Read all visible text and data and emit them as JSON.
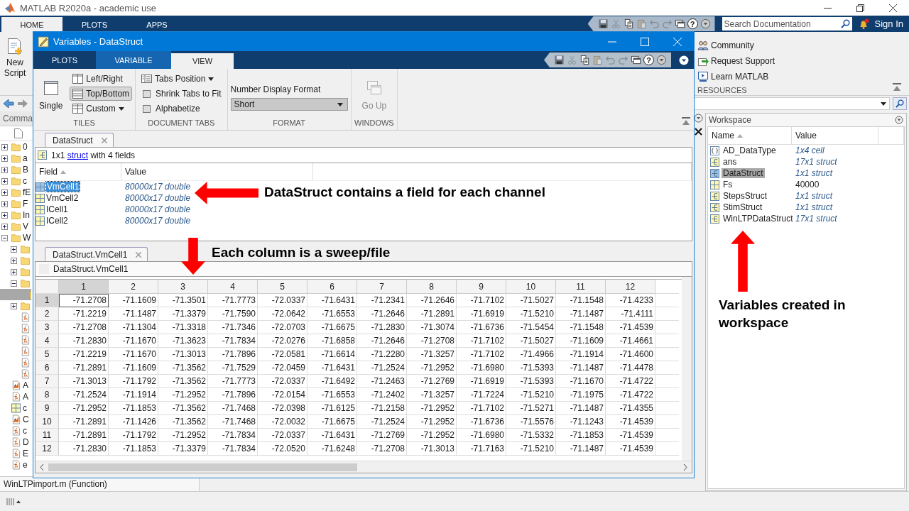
{
  "title": "MATLAB R2020a - academic use",
  "main_tabs": [
    {
      "label": "HOME",
      "selected": true
    },
    {
      "label": "PLOTS",
      "selected": false
    },
    {
      "label": "APPS",
      "selected": false
    }
  ],
  "quick_access": {
    "help": "?"
  },
  "search": {
    "placeholder": "Search Documentation"
  },
  "sign_in": "Sign In",
  "new_script": "New Script",
  "resources": {
    "group_label": "RESOURCES",
    "items": [
      {
        "label": "Community",
        "kind": "community"
      },
      {
        "label": "Request Support",
        "kind": "support"
      },
      {
        "label": "Learn MATLAB",
        "kind": "learn"
      }
    ]
  },
  "current_folder": {
    "header": "Comma",
    "items": [
      {
        "kind": "folder",
        "label": "0",
        "expanded": false,
        "selected": false
      },
      {
        "kind": "folder",
        "label": "a",
        "expanded": false,
        "selected": false
      },
      {
        "kind": "folder",
        "label": "B",
        "expanded": false,
        "selected": false
      },
      {
        "kind": "folder",
        "label": "c",
        "expanded": false,
        "selected": false
      },
      {
        "kind": "folder",
        "label": "fE",
        "expanded": false,
        "selected": false
      },
      {
        "kind": "folder",
        "label": "F",
        "expanded": false,
        "selected": false
      },
      {
        "kind": "folder",
        "label": "In",
        "expanded": false,
        "selected": false
      },
      {
        "kind": "folder",
        "label": "V",
        "expanded": false,
        "selected": false
      },
      {
        "kind": "folder",
        "label": "W",
        "expanded": true,
        "selected": false,
        "children": [
          {
            "kind": "folder",
            "expanded": false,
            "selected": false
          },
          {
            "kind": "folder",
            "expanded": false,
            "selected": false
          },
          {
            "kind": "folder",
            "expanded": false,
            "selected": false
          },
          {
            "kind": "folder",
            "expanded": true,
            "selected": false,
            "children": [
              {
                "kind": "folder",
                "selected": true
              }
            ]
          },
          {
            "kind": "folder",
            "expanded": false,
            "selected": false
          },
          {
            "kind": "function",
            "selected": false
          },
          {
            "kind": "function",
            "selected": false
          },
          {
            "kind": "function",
            "selected": false
          },
          {
            "kind": "function",
            "selected": false
          },
          {
            "kind": "function",
            "selected": false
          },
          {
            "kind": "function",
            "selected": false
          }
        ]
      },
      {
        "kind": "live",
        "label": "A",
        "selected": false
      },
      {
        "kind": "function",
        "label": "A",
        "selected": false
      },
      {
        "kind": "data",
        "label": "c",
        "selected": false
      },
      {
        "kind": "live",
        "label": "C",
        "selected": false
      },
      {
        "kind": "function",
        "label": "c",
        "selected": false
      },
      {
        "kind": "function",
        "label": "D",
        "selected": false
      },
      {
        "kind": "function",
        "label": "E",
        "selected": false
      },
      {
        "kind": "function",
        "label": "e",
        "selected": false
      }
    ]
  },
  "editor_status": "WinLTPimport.m  (Function)",
  "workspace": {
    "title": "Workspace",
    "columns": [
      "Name",
      "Value"
    ],
    "rows": [
      {
        "name": "AD_DataType",
        "value": "1x4 cell",
        "kind": "cell",
        "selected": false
      },
      {
        "name": "ans",
        "value": "17x1 struct",
        "kind": "struct",
        "selected": false
      },
      {
        "name": "DataStruct",
        "value": "1x1 struct",
        "kind": "struct",
        "selected": true
      },
      {
        "name": "Fs",
        "value": "40000",
        "kind": "scalar",
        "selected": false
      },
      {
        "name": "StepsStruct",
        "value": "1x1 struct",
        "kind": "struct",
        "selected": false
      },
      {
        "name": "StimStruct",
        "value": "1x1 struct",
        "kind": "struct",
        "selected": false
      },
      {
        "name": "WinLTPDataStruct",
        "value": "17x1 struct",
        "kind": "struct",
        "selected": false
      }
    ]
  },
  "variables_window": {
    "title": "Variables - DataStruct",
    "tabs": [
      {
        "label": "PLOTS",
        "selected": false
      },
      {
        "label": "VARIABLE",
        "selected": false
      },
      {
        "label": "VIEW",
        "selected": true
      }
    ],
    "quick_access": {
      "help": "?"
    },
    "tiles": {
      "label": "TILES",
      "buttons": [
        {
          "label": "Single",
          "kind": "large",
          "selected": false
        },
        {
          "label": "Left/Right",
          "kind": "small",
          "selected": false
        },
        {
          "label": "Top/Bottom",
          "kind": "small",
          "selected": true
        },
        {
          "label": "Custom",
          "kind": "menu",
          "selected": false
        }
      ]
    },
    "document_tabs": {
      "label": "DOCUMENT TABS",
      "tabs_position": "Tabs Position",
      "checkboxes": [
        {
          "label": "Shrink Tabs to Fit",
          "checked": false
        },
        {
          "label": "Alphabetize",
          "checked": false
        }
      ]
    },
    "format": {
      "label": "FORMAT",
      "field_label": "Number Display Format",
      "value": "Short"
    },
    "windows": {
      "label": "WINDOWS",
      "go_up": {
        "label": "Go Up",
        "disabled": true
      }
    },
    "struct_tab": "DataStruct",
    "summary": {
      "before": "1x1",
      "link": "struct",
      "after": "with 4 fields"
    },
    "fields": {
      "columns": [
        "Field",
        "Value"
      ],
      "rows": [
        {
          "name": "VmCell1",
          "value": "80000x17 double",
          "selected": true
        },
        {
          "name": "VmCell2",
          "value": "80000x17 double",
          "selected": false
        },
        {
          "name": "ICell1",
          "value": "80000x17 double",
          "selected": false
        },
        {
          "name": "ICell2",
          "value": "80000x17 double",
          "selected": false
        }
      ]
    },
    "matrix_tab": "DataStruct.VmCell1",
    "matrix_path": "DataStruct.VmCell1",
    "grid": {
      "columns": [
        {
          "label": "1",
          "selected": true
        },
        {
          "label": "2",
          "selected": false
        },
        {
          "label": "3",
          "selected": false
        },
        {
          "label": "4",
          "selected": false
        },
        {
          "label": "5",
          "selected": false
        },
        {
          "label": "6",
          "selected": false
        },
        {
          "label": "7",
          "selected": false
        },
        {
          "label": "8",
          "selected": false
        },
        {
          "label": "9",
          "selected": false
        },
        {
          "label": "10",
          "selected": false
        },
        {
          "label": "11",
          "selected": false
        },
        {
          "label": "12",
          "selected": false
        }
      ],
      "rows": [
        {
          "label": "1",
          "selected": true,
          "cells": [
            "-71.2708",
            "-71.1609",
            "-71.3501",
            "-71.7773",
            "-72.0337",
            "-71.6431",
            "-71.2341",
            "-71.2646",
            "-71.7102",
            "-71.5027",
            "-71.1548",
            "-71.4233"
          ]
        },
        {
          "label": "2",
          "selected": false,
          "cells": [
            "-71.2219",
            "-71.1487",
            "-71.3379",
            "-71.7590",
            "-72.0642",
            "-71.6553",
            "-71.2646",
            "-71.2891",
            "-71.6919",
            "-71.5210",
            "-71.1487",
            "-71.4111"
          ]
        },
        {
          "label": "3",
          "selected": false,
          "cells": [
            "-71.2708",
            "-71.1304",
            "-71.3318",
            "-71.7346",
            "-72.0703",
            "-71.6675",
            "-71.2830",
            "-71.3074",
            "-71.6736",
            "-71.5454",
            "-71.1548",
            "-71.4539"
          ]
        },
        {
          "label": "4",
          "selected": false,
          "cells": [
            "-71.2830",
            "-71.1670",
            "-71.3623",
            "-71.7834",
            "-72.0276",
            "-71.6858",
            "-71.2646",
            "-71.2708",
            "-71.7102",
            "-71.5027",
            "-71.1609",
            "-71.4661"
          ]
        },
        {
          "label": "5",
          "selected": false,
          "cells": [
            "-71.2219",
            "-71.1670",
            "-71.3013",
            "-71.7896",
            "-72.0581",
            "-71.6614",
            "-71.2280",
            "-71.3257",
            "-71.7102",
            "-71.4966",
            "-71.1914",
            "-71.4600"
          ]
        },
        {
          "label": "6",
          "selected": false,
          "cells": [
            "-71.2891",
            "-71.1609",
            "-71.3562",
            "-71.7529",
            "-72.0459",
            "-71.6431",
            "-71.2524",
            "-71.2952",
            "-71.6980",
            "-71.5393",
            "-71.1487",
            "-71.4478"
          ]
        },
        {
          "label": "7",
          "selected": false,
          "cells": [
            "-71.3013",
            "-71.1792",
            "-71.3562",
            "-71.7773",
            "-72.0337",
            "-71.6492",
            "-71.2463",
            "-71.2769",
            "-71.6919",
            "-71.5393",
            "-71.1670",
            "-71.4722"
          ]
        },
        {
          "label": "8",
          "selected": false,
          "cells": [
            "-71.2524",
            "-71.1914",
            "-71.2952",
            "-71.7896",
            "-72.0154",
            "-71.6553",
            "-71.2402",
            "-71.3257",
            "-71.7224",
            "-71.5210",
            "-71.1975",
            "-71.4722"
          ]
        },
        {
          "label": "9",
          "selected": false,
          "cells": [
            "-71.2952",
            "-71.1853",
            "-71.3562",
            "-71.7468",
            "-72.0398",
            "-71.6125",
            "-71.2158",
            "-71.2952",
            "-71.7102",
            "-71.5271",
            "-71.1487",
            "-71.4355"
          ]
        },
        {
          "label": "10",
          "selected": false,
          "cells": [
            "-71.2891",
            "-71.1426",
            "-71.3562",
            "-71.7468",
            "-72.0032",
            "-71.6675",
            "-71.2524",
            "-71.2952",
            "-71.6736",
            "-71.5576",
            "-71.1243",
            "-71.4539"
          ]
        },
        {
          "label": "11",
          "selected": false,
          "cells": [
            "-71.2891",
            "-71.1792",
            "-71.2952",
            "-71.7834",
            "-72.0337",
            "-71.6431",
            "-71.2769",
            "-71.2952",
            "-71.6980",
            "-71.5332",
            "-71.1853",
            "-71.4539"
          ]
        },
        {
          "label": "12",
          "selected": false,
          "cells": [
            "-71.2830",
            "-71.1853",
            "-71.3379",
            "-71.7834",
            "-72.0520",
            "-71.6248",
            "-71.2708",
            "-71.3013",
            "-71.7163",
            "-71.5210",
            "-71.1487",
            "-71.4539"
          ]
        }
      ]
    }
  },
  "annotations": [
    {
      "text": "DataStruct contains a field for each channel",
      "kind": "left"
    },
    {
      "text": "Each column is a sweep/file",
      "kind": "down"
    },
    {
      "text": "Variables created in workspace",
      "kind": "up"
    }
  ]
}
